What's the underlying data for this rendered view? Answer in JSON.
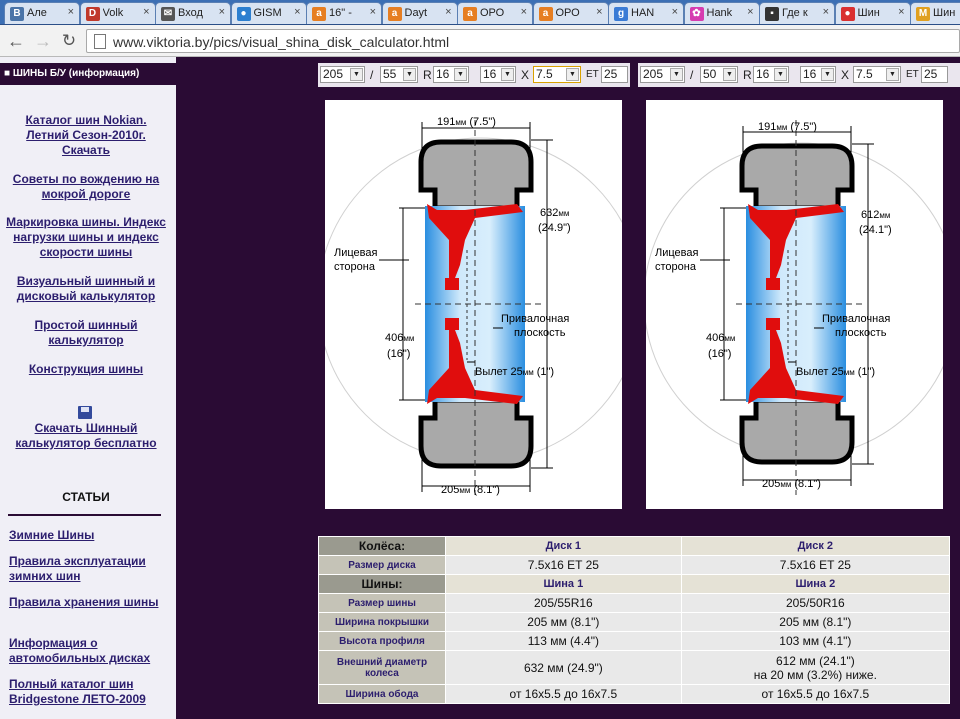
{
  "tabs": [
    {
      "title": "Але",
      "icon": "В",
      "color": "#4a74a8"
    },
    {
      "title": "Volk",
      "icon": "D",
      "color": "#c0392b"
    },
    {
      "title": "Вход",
      "icon": "✉",
      "color": "#555555"
    },
    {
      "title": "GISM",
      "icon": "●",
      "color": "#2c7fd0"
    },
    {
      "title": "16\" -",
      "icon": "a",
      "color": "#e67e22"
    },
    {
      "title": "Dayt",
      "icon": "a",
      "color": "#e67e22"
    },
    {
      "title": "ОРО",
      "icon": "a",
      "color": "#e67e22"
    },
    {
      "title": "ОРО",
      "icon": "a",
      "color": "#e67e22"
    },
    {
      "title": "HAN",
      "icon": "g",
      "color": "#3a7bd5"
    },
    {
      "title": "Hank",
      "icon": "✿",
      "color": "#d63cb0"
    },
    {
      "title": "Где к",
      "icon": "▪",
      "color": "#333333"
    },
    {
      "title": "Шин",
      "icon": "●",
      "color": "#d93030"
    },
    {
      "title": "Шин",
      "icon": "M",
      "color": "#e0a020"
    }
  ],
  "url": "www.viktoria.by/pics/visual_shina_disk_calculator.html",
  "sidebar": {
    "top": "■  ШИНЫ Б/У (информация)",
    "links": [
      "Каталог шин Nokian. Летний Сезон-2010г. Скачать",
      "Советы по вождению на мокрой дороге",
      "Маркировка шины. Индекс нагрузки шины и индекс скорости шины",
      "Визуальный шинный и дисковый калькулятор",
      "Простой шинный калькулятор",
      "Конструкция шины"
    ],
    "download": "Скачать Шинный калькулятор бесплатно",
    "articles_head": "СТАТЬИ",
    "articles": [
      "Зимние Шины",
      "Правила эксплуатации зимних шин",
      "Правила хранения шины",
      "Информация о автомобильных дисках",
      "Полный каталог шин Bridgestone ЛЕТО-2009"
    ]
  },
  "calc1": {
    "width": "205",
    "profile": "55",
    "r": "R",
    "rim": "16",
    "rim2": "16",
    "x": "X",
    "j": "7.5",
    "et": "ET",
    "et_val": "25",
    "sep": "/"
  },
  "calc2": {
    "width": "205",
    "profile": "50",
    "r": "R",
    "rim": "16",
    "rim2": "16",
    "x": "X",
    "j": "7.5",
    "et": "ET",
    "et_val": "25",
    "sep": "/"
  },
  "diagram1": {
    "top_mm": "191",
    "top_in": "(7.5\")",
    "outer_mm": "632",
    "outer_in": "(24.9\")",
    "front_1": "Лицевая",
    "front_2": "сторона",
    "mount_1": "Привалочная",
    "mount_2": "плоскость",
    "rim_mm": "406",
    "rim_in": "(16\")",
    "offset": "Вылет 25",
    "offset_in": "(1\")",
    "bottom_mm": "205",
    "bottom_in": "(8.1\")",
    "mm": "мм"
  },
  "diagram2": {
    "top_mm": "191",
    "top_in": "(7.5\")",
    "outer_mm": "612",
    "outer_in": "(24.1\")",
    "front_1": "Лицевая",
    "front_2": "сторона",
    "mount_1": "Привалочная",
    "mount_2": "плоскость",
    "rim_mm": "406",
    "rim_in": "(16\")",
    "offset": "Вылет 25",
    "offset_in": "(1\")",
    "bottom_mm": "205",
    "bottom_in": "(8.1\")",
    "mm": "мм"
  },
  "table": {
    "wheels": "Колёса:",
    "disk1": "Диск 1",
    "disk2": "Диск 2",
    "disk_size": "Размер диска",
    "ds1": "7.5x16 ET 25",
    "ds2": "7.5x16 ET 25",
    "tires": "Шины:",
    "tire1": "Шина 1",
    "tire2": "Шина 2",
    "rows": [
      {
        "label": "Размер шины",
        "v1": "205/55R16",
        "v2": "205/50R16"
      },
      {
        "label": "Ширина покрышки",
        "v1": "205 мм (8.1\")",
        "v2": "205 мм (8.1\")"
      },
      {
        "label": "Высота профиля",
        "v1": "113 мм (4.4\")",
        "v2": "103 мм (4.1\")"
      },
      {
        "label": "Внешний диаметр колеса",
        "v1": "632 мм (24.9\")",
        "v2": "612 мм (24.1\")",
        "v2b": "на 20 мм (3.2%) ниже."
      },
      {
        "label": "Ширина обода",
        "v1": "от 16x5.5 до 16x7.5",
        "v2": "от 16x5.5 до 16x7.5"
      }
    ]
  }
}
